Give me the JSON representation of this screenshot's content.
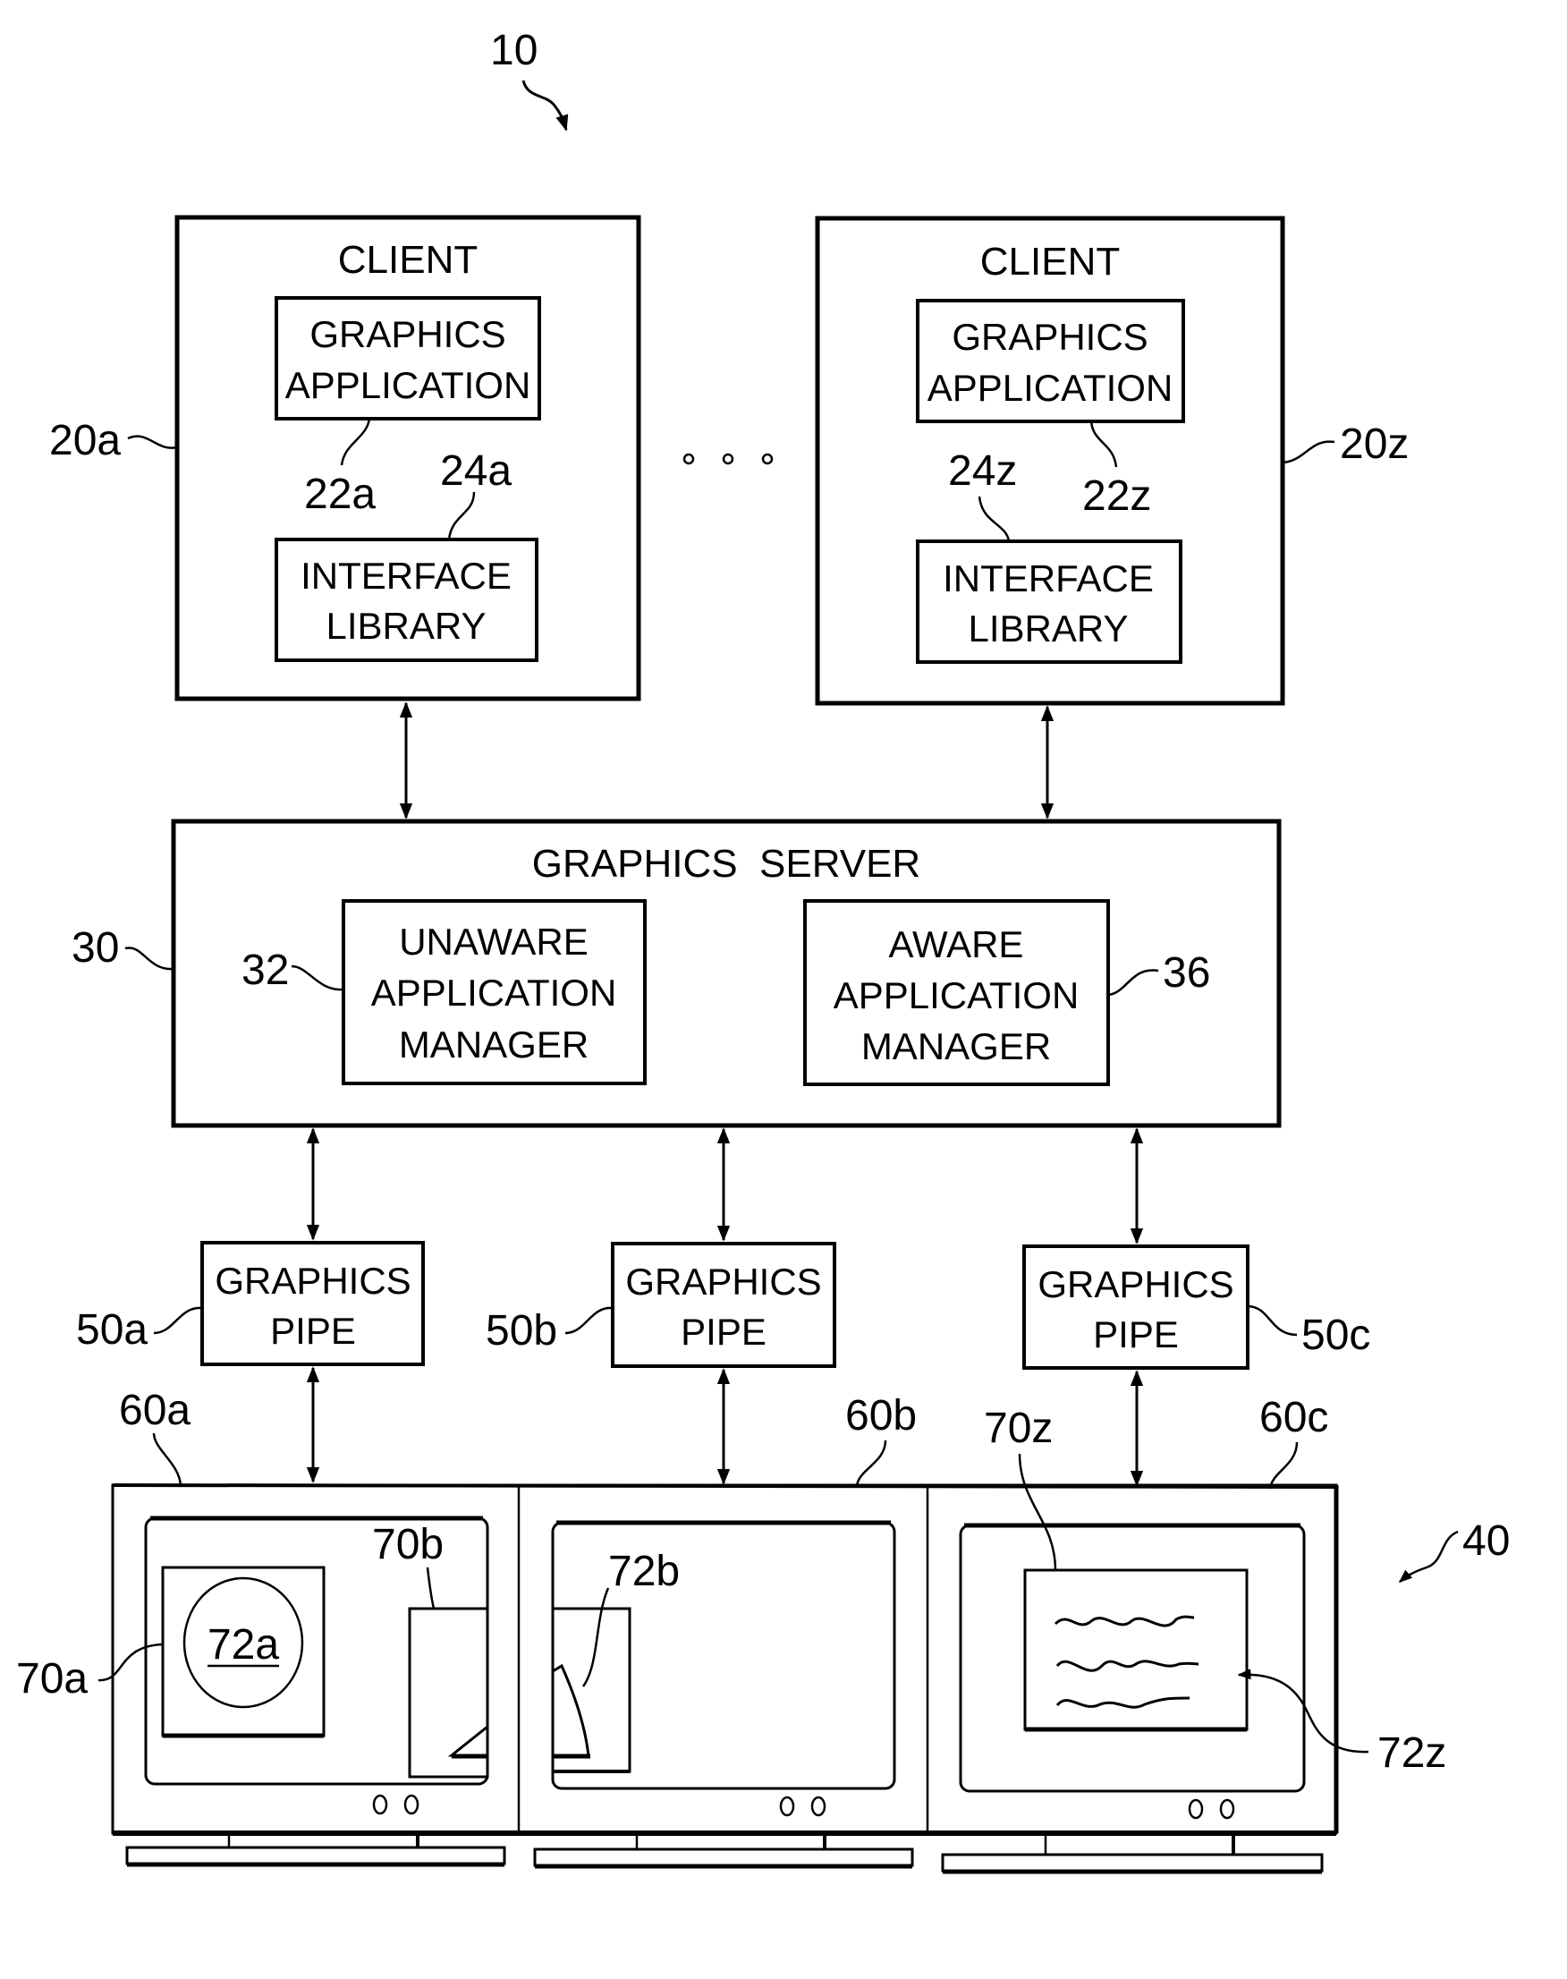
{
  "figure_ref": "10",
  "clients": [
    {
      "ref": "20a",
      "title": "CLIENT",
      "app": {
        "ref": "22a",
        "line1": "GRAPHICS",
        "line2": "APPLICATION"
      },
      "lib": {
        "ref": "24a",
        "line1": "INTERFACE",
        "line2": "LIBRARY"
      }
    },
    {
      "ref": "20z",
      "title": "CLIENT",
      "app": {
        "ref": "22z",
        "line1": "GRAPHICS",
        "line2": "APPLICATION"
      },
      "lib": {
        "ref": "24z",
        "line1": "INTERFACE",
        "line2": "LIBRARY"
      }
    }
  ],
  "ellipsis": "o o o",
  "server": {
    "ref": "30",
    "title": "GRAPHICS  SERVER",
    "unaware": {
      "ref": "32",
      "line1": "UNAWARE",
      "line2": "APPLICATION",
      "line3": "MANAGER"
    },
    "aware": {
      "ref": "36",
      "line1": "AWARE",
      "line2": "APPLICATION",
      "line3": "MANAGER"
    }
  },
  "pipes": [
    {
      "ref": "50a",
      "line1": "GRAPHICS",
      "line2": "PIPE"
    },
    {
      "ref": "50b",
      "line1": "GRAPHICS",
      "line2": "PIPE"
    },
    {
      "ref": "50c",
      "line1": "GRAPHICS",
      "line2": "PIPE"
    }
  ],
  "display": {
    "ref": "40",
    "monitors": [
      {
        "ref": "60a"
      },
      {
        "ref": "60b"
      },
      {
        "ref": "60c"
      }
    ],
    "windows": {
      "w70a": "70a",
      "w70b": "70b",
      "w70z": "70z"
    },
    "objects": {
      "o72a": "72a",
      "o72b": "72b",
      "o72z": "72z"
    }
  }
}
